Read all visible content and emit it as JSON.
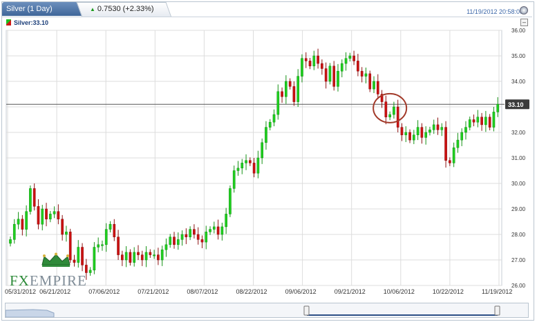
{
  "header": {
    "tab_title": "Silver (1 Day)",
    "change": "0.7530 (+2.33%)",
    "timestamp": "11/19/2012 20:58:00"
  },
  "legend": {
    "label": "Silver:33.10"
  },
  "logo": {
    "fx": "FX",
    "empire": "EMPIRE"
  },
  "colors": {
    "up": "#1fcf1f",
    "down": "#cc1111",
    "last_line": "#555555",
    "grid": "#dcdcdc"
  },
  "chart_data": {
    "type": "candlestick",
    "title": "Silver (1 Day)",
    "last_price": 33.1,
    "last_price_label": "33.10",
    "ylim": [
      26.0,
      36.0
    ],
    "y_ticks": [
      "26.00",
      "27.00",
      "28.00",
      "29.00",
      "30.00",
      "31.00",
      "32.00",
      "33.00",
      "34.00",
      "35.00",
      "36.00"
    ],
    "x_ticks": [
      "05/31/2012",
      "06/21/2012",
      "07/06/2012",
      "07/21/2012",
      "08/07/2012",
      "08/22/2012",
      "09/06/2012",
      "09/21/2012",
      "10/06/2012",
      "10/22/2012",
      "11/19/2012"
    ],
    "grid": true,
    "annotation": "red ellipse around late October consolidation",
    "closes": [
      27.8,
      28.4,
      28.6,
      28.2,
      28.9,
      29.8,
      29.1,
      28.4,
      29.0,
      28.6,
      28.8,
      28.9,
      28.6,
      28.0,
      28.1,
      27.0,
      26.9,
      27.5,
      26.8,
      26.5,
      26.6,
      27.5,
      27.6,
      27.6,
      28.2,
      28.4,
      27.9,
      27.2,
      27.0,
      27.3,
      26.9,
      27.3,
      27.2,
      27.0,
      27.3,
      27.2,
      27.2,
      27.0,
      27.4,
      27.6,
      27.9,
      27.6,
      27.8,
      28.0,
      27.9,
      28.2,
      28.0,
      27.8,
      27.7,
      28.1,
      28.2,
      28.3,
      28.0,
      28.3,
      28.8,
      29.8,
      30.5,
      30.6,
      30.8,
      30.9,
      30.8,
      30.4,
      31.0,
      31.6,
      32.2,
      32.4,
      32.7,
      33.6,
      33.4,
      34.0,
      33.8,
      33.2,
      34.2,
      34.9,
      34.8,
      34.6,
      35.0,
      34.7,
      34.5,
      34.0,
      34.6,
      33.8,
      34.4,
      34.7,
      34.9,
      35.0,
      34.8,
      34.4,
      34.2,
      34.3,
      33.7,
      34.0,
      33.5,
      33.2,
      32.6,
      32.7,
      33.0,
      32.2,
      31.9,
      32.0,
      31.7,
      31.9,
      32.2,
      31.8,
      32.0,
      32.1,
      32.3,
      32.1,
      32.2,
      30.9,
      30.8,
      31.4,
      31.7,
      32.0,
      32.2,
      32.5,
      32.4,
      32.6,
      32.3,
      32.6,
      32.2,
      32.8,
      33.1
    ]
  }
}
